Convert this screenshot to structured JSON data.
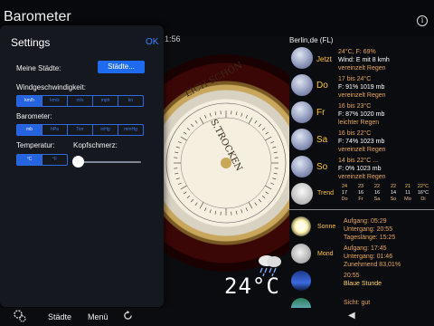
{
  "app": {
    "title": "Barometer",
    "info_label": "i",
    "time": "1:56"
  },
  "barometer": {
    "brand_left": "LICH SCHÖN",
    "brand_right": "S.TROCKEN",
    "temperature": "24°C"
  },
  "forecast": {
    "location": "Berlin,de (FL)",
    "days": [
      {
        "day": "Jetzt",
        "line1": "24°C, F: 69%",
        "line2": "Wind: E mit 8 kmh",
        "line3": "vereinzelt Regen"
      },
      {
        "day": "Do",
        "line1": "17 bis 24°C",
        "line2": "F: 91% 1019 mb",
        "line3": "vereinzelt Regen"
      },
      {
        "day": "Fr",
        "line1": "16 bis 23°C",
        "line2": "F: 87% 1020 mb",
        "line3": "leichter Regen"
      },
      {
        "day": "Sa",
        "line1": "16 bis 22°C",
        "line2": "F: 74% 1023 mb",
        "line3": "vereinzelt Regen"
      },
      {
        "day": "So",
        "line1": "14 bis 22°C ...",
        "line2": "F: 0% 1023 mb",
        "line3": "vereinzelt Regen"
      }
    ],
    "trend": {
      "label": "Trend",
      "columns": [
        {
          "hi": "24",
          "lo": "17",
          "day": "Do"
        },
        {
          "hi": "23",
          "lo": "16",
          "day": "Fr"
        },
        {
          "hi": "22",
          "lo": "16",
          "day": "Sa"
        },
        {
          "hi": "22",
          "lo": "14",
          "day": "So"
        },
        {
          "hi": "21",
          "lo": "11",
          "day": "Mo"
        },
        {
          "hi": "22°C",
          "lo": "16°C",
          "day": "Di"
        }
      ]
    }
  },
  "astro": {
    "sun": {
      "label": "Sonne",
      "line1": "Aufgang: 05:29",
      "line2": "Untergang: 20:55",
      "line3": "Tageslänge: 15:25"
    },
    "moon": {
      "label": "Mond",
      "line1": "Aufgang: 17:45",
      "line2": "Untergang: 01:46",
      "line3": "Zunehmend 83,01%"
    },
    "blue_hour": {
      "line1": "20:55",
      "line2": "Blaue Stunde"
    },
    "visibility": {
      "line1": "Sicht: gut"
    }
  },
  "settings": {
    "title": "Settings",
    "ok": "OK",
    "cities_label": "Meine Städte:",
    "cities_button": "Städte...",
    "wind_label": "Windgeschwindigkeit:",
    "wind_options": [
      "km/h",
      "km/s",
      "m/s",
      "mph",
      "kn"
    ],
    "pressure_label": "Barometer:",
    "pressure_options": [
      "mb",
      "hPa",
      "Torr",
      "inHg",
      "mmHg"
    ],
    "temp_label": "Temperatur:",
    "temp_options": [
      "°C",
      "°F"
    ],
    "headache_label": "Kopfschmerz:",
    "headache_level": 0
  },
  "bottom_bar": {
    "cities": "Städte",
    "menu": "Menü"
  }
}
